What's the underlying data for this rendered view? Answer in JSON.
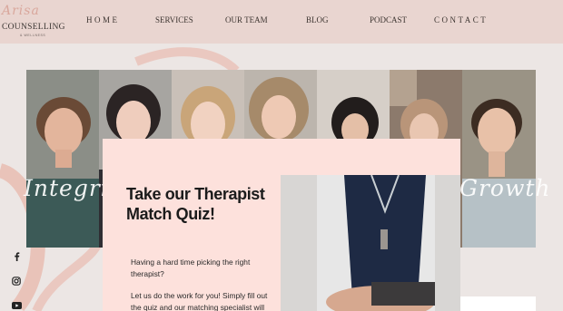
{
  "logo": {
    "script": "Arisa",
    "main": "COUNSELLING",
    "sub": "& WELLNESS"
  },
  "nav": {
    "items": [
      {
        "label": "HOME"
      },
      {
        "label": "SERVICES"
      },
      {
        "label": "OUR TEAM"
      },
      {
        "label": "BLOG"
      },
      {
        "label": "PODCAST"
      },
      {
        "label": "CONTACT"
      }
    ]
  },
  "hero": {
    "word_left": "Integrity",
    "word_right": "Growth"
  },
  "quiz": {
    "title": "Take our Therapist Match Quiz!",
    "paragraph_1": "Having a hard time picking the right therapist?",
    "paragraph_2": "Let us do the work for you! Simply fill out the quiz and our matching specialist will"
  },
  "social": {
    "icons": [
      "facebook-icon",
      "instagram-icon",
      "youtube-icon"
    ]
  },
  "colors": {
    "nav_bg": "#e9d5d0",
    "page_bg": "#ece6e4",
    "card_bg": "#fde1dc",
    "accent": "#e8a595"
  }
}
